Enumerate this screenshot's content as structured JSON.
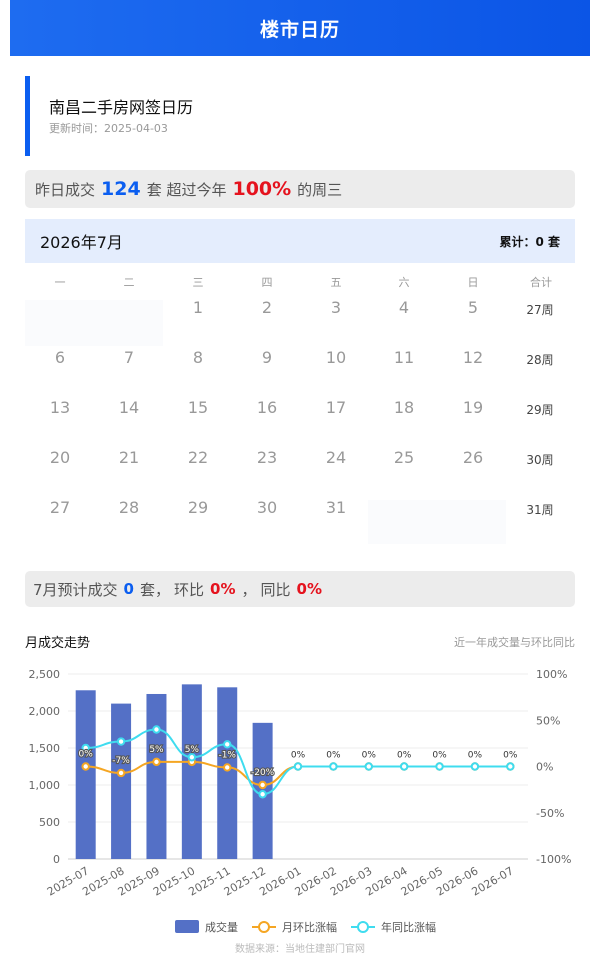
{
  "header": {
    "title": "楼市日历"
  },
  "info": {
    "title": "南昌二手房网签日历",
    "updated": "更新时间：2025-04-03"
  },
  "summary": {
    "prefix": "昨日成交",
    "count": "124",
    "mid": "套 超过今年",
    "percent": "100%",
    "suffix": "的周三"
  },
  "calendar": {
    "month": "2026年7月",
    "total": "累计：0 套",
    "weekdays": [
      "一",
      "二",
      "三",
      "四",
      "五",
      "六",
      "日",
      "合计"
    ],
    "rows": [
      {
        "days": [
          "",
          "",
          "1",
          "2",
          "3",
          "4",
          "5"
        ],
        "week": "27周"
      },
      {
        "days": [
          "6",
          "7",
          "8",
          "9",
          "10",
          "11",
          "12"
        ],
        "week": "28周"
      },
      {
        "days": [
          "13",
          "14",
          "15",
          "16",
          "17",
          "18",
          "19"
        ],
        "week": "29周"
      },
      {
        "days": [
          "20",
          "21",
          "22",
          "23",
          "24",
          "25",
          "26"
        ],
        "week": "30周"
      },
      {
        "days": [
          "27",
          "28",
          "29",
          "30",
          "31",
          "",
          ""
        ],
        "week": "31周"
      }
    ]
  },
  "forecast": {
    "prefix": "7月预计成交",
    "count": "0",
    "mid1": "套，",
    "mom_label": "环比",
    "mom": "0%",
    "mid2": "，",
    "yoy_label": "同比",
    "yoy": "0%"
  },
  "trend": {
    "title": "月成交走势",
    "subtitle": "近一年成交量与环比同比"
  },
  "chart_data": {
    "type": "bar",
    "categories": [
      "2025-07",
      "2025-08",
      "2025-09",
      "2025-10",
      "2025-11",
      "2025-12",
      "2026-01",
      "2026-02",
      "2026-03",
      "2026-04",
      "2026-05",
      "2026-06",
      "2026-07"
    ],
    "left_axis_ticks": [
      "0",
      "500",
      "1,000",
      "1,500",
      "2,000",
      "2,500"
    ],
    "right_axis_ticks": [
      "-100%",
      "-50%",
      "0%",
      "50%",
      "100%"
    ],
    "ylim": [
      0,
      2500
    ],
    "y2lim": [
      -100,
      100
    ],
    "series": [
      {
        "name": "成交量",
        "kind": "bar",
        "color": "#5470c6",
        "values": [
          2280,
          2100,
          2230,
          2360,
          2320,
          1840,
          null,
          null,
          null,
          null,
          null,
          null,
          null
        ]
      },
      {
        "name": "月环比涨幅",
        "kind": "line",
        "color": "#f5a623",
        "values": [
          0,
          -7,
          5,
          5,
          -1,
          -20,
          0,
          0,
          0,
          0,
          0,
          0,
          0
        ]
      },
      {
        "name": "年同比涨幅",
        "kind": "line",
        "color": "#3fdcef",
        "values": [
          20,
          27,
          40,
          10,
          24,
          -30,
          0,
          0,
          0,
          0,
          0,
          0,
          0
        ]
      }
    ],
    "data_labels": [
      "0%",
      "-7%",
      "5%",
      "5%",
      "-1%",
      "-20%",
      "0%",
      "0%",
      "0%",
      "0%",
      "0%",
      "0%",
      "0%"
    ],
    "legend_position": "bottom",
    "grid": true
  },
  "footer": {
    "source": "数据来源：当地住建部门官网"
  }
}
